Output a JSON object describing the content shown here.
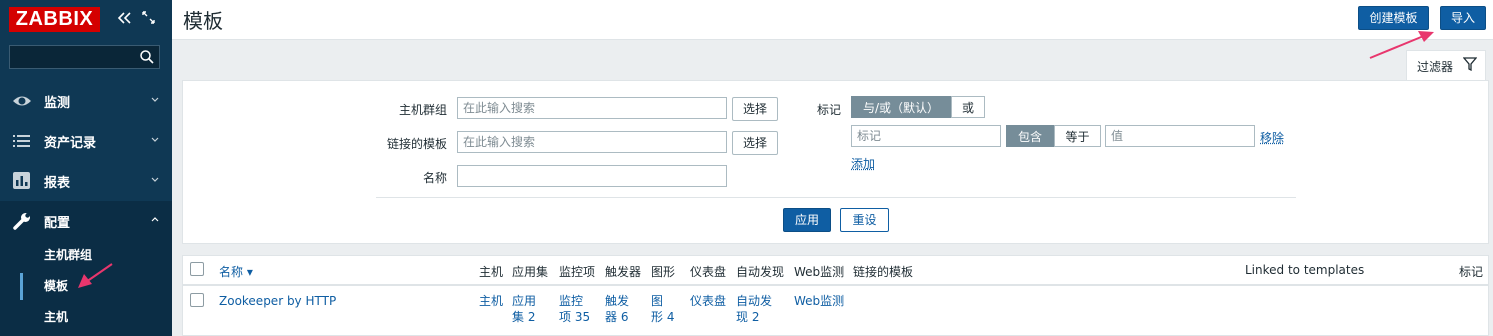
{
  "app": {
    "logo": "ZABBIX"
  },
  "sidebar": {
    "search_placeholder": "",
    "items": [
      {
        "label": "监测",
        "icon": "eye-icon"
      },
      {
        "label": "资产记录",
        "icon": "list-icon"
      },
      {
        "label": "报表",
        "icon": "bar-chart-icon"
      },
      {
        "label": "配置",
        "icon": "wrench-icon"
      }
    ],
    "submenu": [
      {
        "label": "主机群组"
      },
      {
        "label": "模板"
      },
      {
        "label": "主机"
      }
    ]
  },
  "header": {
    "title": "模板",
    "create_button": "创建模板",
    "import_button": "导入"
  },
  "filter": {
    "tab_label": "过滤器",
    "host_group_label": "主机群组",
    "host_group_placeholder": "在此输入搜索",
    "select_label": "选择",
    "linked_templates_label": "链接的模板",
    "linked_templates_placeholder": "在此输入搜索",
    "name_label": "名称",
    "name_value": "",
    "tags_label": "标记",
    "and_or_label": "与/或（默认）",
    "or_label": "或",
    "tag_placeholder": "标记",
    "contains_label": "包含",
    "equals_label": "等于",
    "value_placeholder": "值",
    "remove_label": "移除",
    "add_label": "添加",
    "apply_label": "应用",
    "reset_label": "重设"
  },
  "table": {
    "headers": {
      "name": "名称 ▾",
      "hosts": "主机",
      "applications": "应用集",
      "items": "监控项",
      "triggers": "触发器",
      "graphs": "图形",
      "dashboards": "仪表盘",
      "discovery": "自动发现",
      "web": "Web监测",
      "linked_templates": "链接的模板",
      "linked_to_templates": "Linked to templates",
      "tags": "标记"
    },
    "rows": [
      {
        "name": "Zookeeper by HTTP",
        "hosts": "主机",
        "applications_1": "应用",
        "applications_2": "集 2",
        "items_1": "监控",
        "items_2": "项 35",
        "triggers_1": "触发",
        "triggers_2": "器 6",
        "graphs_1": "图",
        "graphs_2": "形 4",
        "dashboards": "仪表盘",
        "discovery_1": "自动发",
        "discovery_2": "现 2",
        "web": "Web监测"
      }
    ]
  },
  "colors": {
    "sidebar": "#0f3854",
    "accent": "#0f5ea3",
    "logo": "#d40000",
    "annotation_arrow": "#e8366d"
  }
}
